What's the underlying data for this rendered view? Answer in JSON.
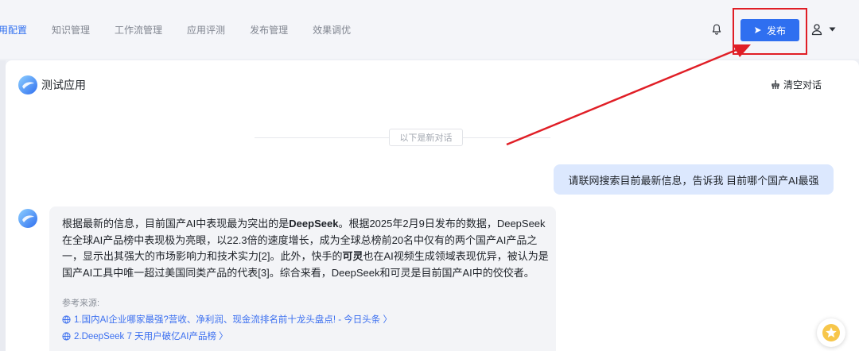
{
  "nav": {
    "tabs": [
      {
        "label": "用配置"
      },
      {
        "label": "知识管理"
      },
      {
        "label": "工作流管理"
      },
      {
        "label": "应用评测"
      },
      {
        "label": "发布管理"
      },
      {
        "label": "效果调优"
      }
    ],
    "bell_icon": "bell-icon",
    "publish_label": "发布",
    "publish_icon": "send-icon",
    "user_icon": "user-icon",
    "caret_icon": "caret-down-icon"
  },
  "chat": {
    "app_title": "测试应用",
    "clear_label": "清空对话",
    "clear_icon": "broom-icon",
    "divider_text": "以下是新对话",
    "user_message": "请联网搜索目前最新信息，告诉我 目前哪个国产AI最强",
    "bot_message": {
      "p1": "根据最新的信息，目前国产AI中表现最为突出的是",
      "b1": "DeepSeek",
      "p2": "。根据2025年2月9日发布的数据，DeepSeek在全球AI产品榜中表现极为亮眼，以22.3倍的速度增长，成为全球总榜前20名中仅有的两个国产AI产品之一，显示出其强大的市场影响力和技术实力[2]。此外，快手的",
      "b2": "可灵",
      "p3": "也在AI视频生成领域表现优异，被认为是国产AI工具中唯一超过美国同类产品的代表[3]。综合来看，DeepSeek和可灵是目前国产AI中的佼佼者。"
    },
    "refs_title": "参考来源:",
    "refs": [
      {
        "label": "1.国内AI企业哪家最强?营收、净利润、现金流排名前十龙头盘点! - 今日头条 〉"
      },
      {
        "label": "2.DeepSeek 7 天用户破亿AI产品榜 〉"
      }
    ]
  },
  "colors": {
    "accent": "#2f6ff0",
    "highlight_frame": "#e01e26",
    "user_bubble": "#dce8fe"
  }
}
